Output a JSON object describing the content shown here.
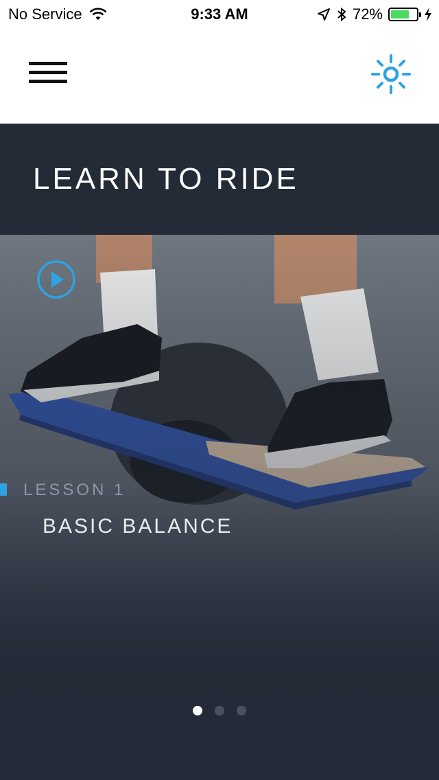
{
  "status_bar": {
    "carrier": "No Service",
    "time": "9:33 AM",
    "battery_percent": "72%",
    "battery_level": 0.72,
    "icons": [
      "wifi-icon",
      "location-icon",
      "bluetooth-icon",
      "battery-icon",
      "charging-icon"
    ]
  },
  "nav": {
    "menu_icon": "hamburger-icon",
    "brightness_icon": "sun-icon",
    "accent_color": "#2ea3e3"
  },
  "page": {
    "title": "LEARN TO RIDE"
  },
  "lesson": {
    "number_label": "LESSON 1",
    "title": "BASIC BALANCE",
    "play_icon": "play-circle-icon"
  },
  "pager": {
    "count": 3,
    "active_index": 0
  },
  "colors": {
    "background": "#242b38",
    "title_band": "#232b37",
    "accent": "#2ea3e3",
    "board": "#2f4f9e"
  }
}
